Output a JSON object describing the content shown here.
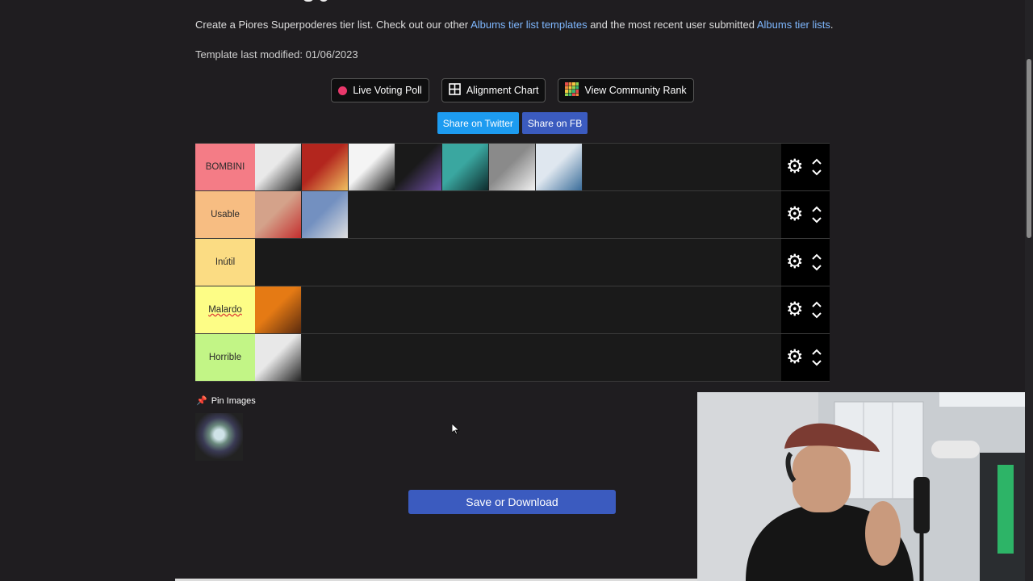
{
  "intro": {
    "text1": "Create a Piores Superpoderes tier list. Check out our other ",
    "link1": "Albums tier list templates",
    "text2": " and the most recent user submitted ",
    "link2": "Albums tier lists",
    "text3": "."
  },
  "modified": "Template last modified: 01/06/2023",
  "buttons": {
    "live_voting": "Live Voting Poll",
    "alignment": "Alignment Chart",
    "community": "View Community Rank"
  },
  "share": {
    "twitter": "Share on Twitter",
    "facebook": "Share on FB"
  },
  "tiers": [
    {
      "label": "BOMBINI",
      "color": "#f47c86",
      "item_count": 7
    },
    {
      "label": "Usable",
      "color": "#f7bd82",
      "item_count": 2
    },
    {
      "label": "Inútil",
      "color": "#fbdc83",
      "item_count": 0
    },
    {
      "label": "Malardo",
      "color": "#fdfd86",
      "item_count": 1
    },
    {
      "label": "Horrible",
      "color": "#c2f586",
      "item_count": 1
    }
  ],
  "pin": {
    "label": "Pin Images"
  },
  "save": "Save or Download",
  "colors": {
    "background": "#1f1d20",
    "link": "#7fb8ff",
    "twitter": "#1d9bf0",
    "facebook": "#3b5bbf",
    "save_button": "#3b5bbf"
  }
}
